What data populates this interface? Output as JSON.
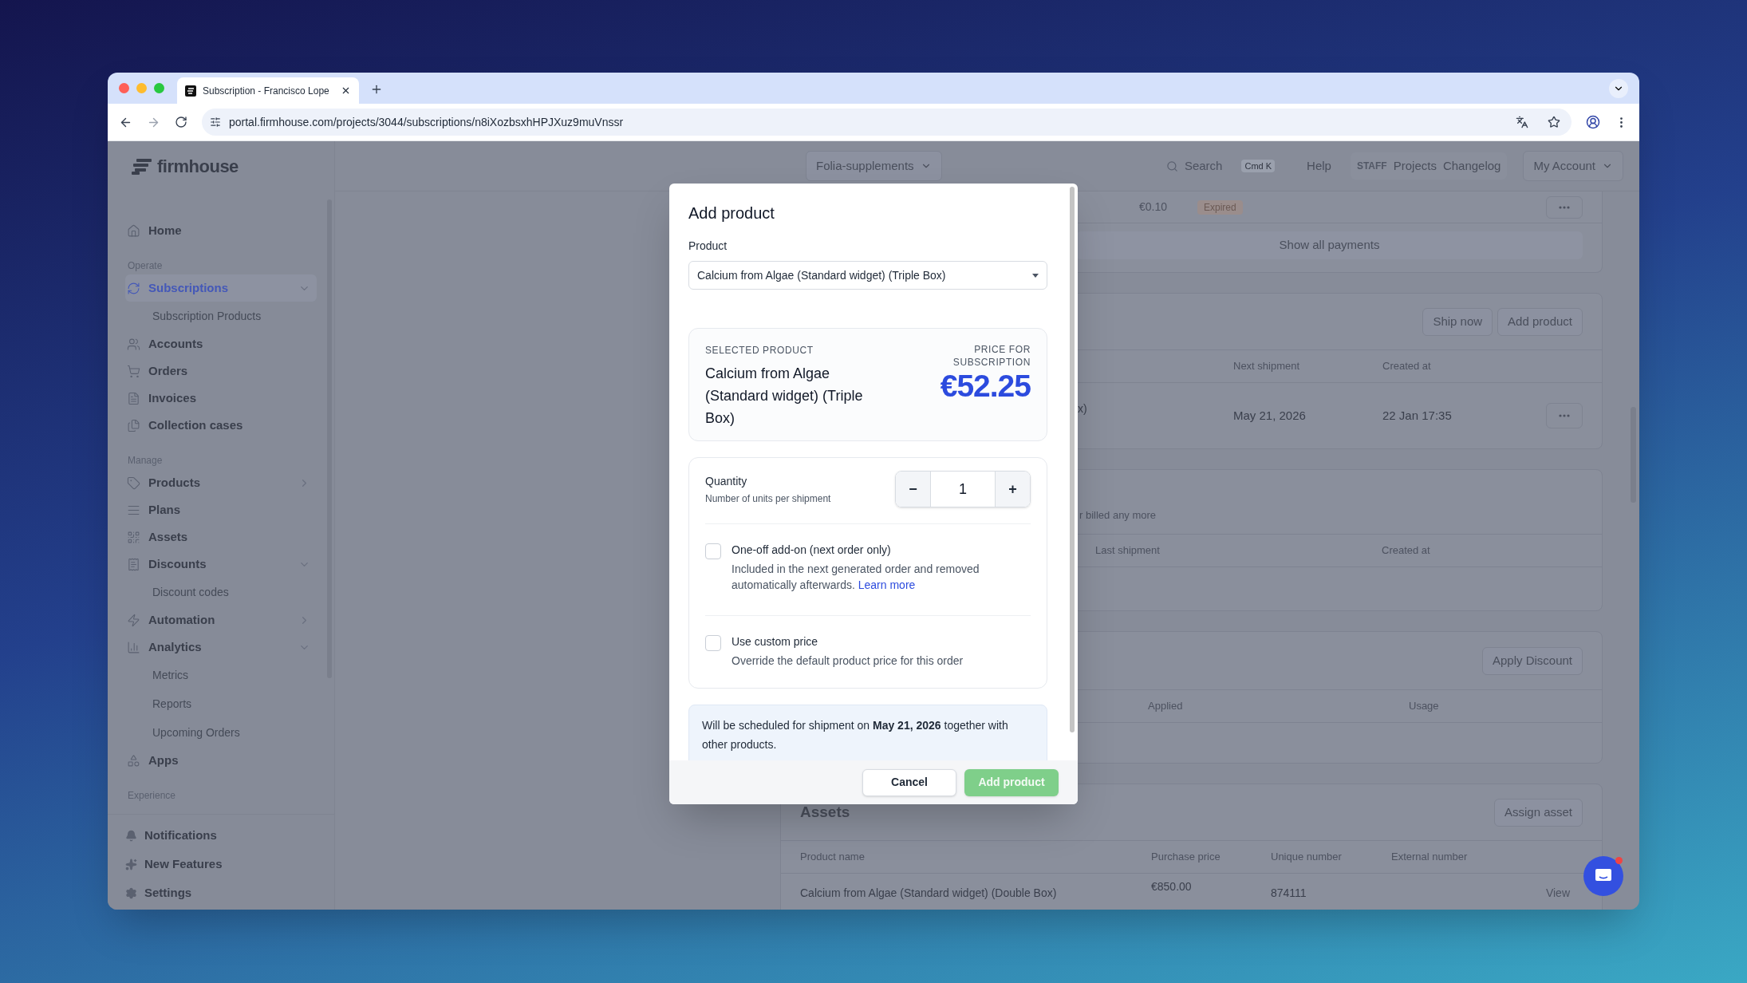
{
  "browser": {
    "tab_title": "Subscription - Francisco Lope",
    "url": "portal.firmhouse.com/projects/3044/subscriptions/n8iXozbsxhHPJXuz9muVnssr"
  },
  "sidebar": {
    "logo": "firmhouse",
    "nav": [
      {
        "kind": "item",
        "label": "Home",
        "selected": false
      },
      {
        "kind": "section",
        "label": "Operate"
      },
      {
        "kind": "item",
        "label": "Subscriptions",
        "selected": true,
        "expanded": true,
        "children": [
          {
            "label": "Subscription Products",
            "selected": false
          }
        ]
      },
      {
        "kind": "item",
        "label": "Accounts",
        "selected": false
      },
      {
        "kind": "item",
        "label": "Orders",
        "selected": false
      },
      {
        "kind": "item",
        "label": "Invoices",
        "selected": false
      },
      {
        "kind": "item",
        "label": "Collection cases",
        "selected": false
      },
      {
        "kind": "section",
        "label": "Manage"
      },
      {
        "kind": "item",
        "label": "Products",
        "selected": false,
        "expanded": false
      },
      {
        "kind": "item",
        "label": "Plans",
        "selected": false
      },
      {
        "kind": "item",
        "label": "Assets",
        "selected": false
      },
      {
        "kind": "item",
        "label": "Discounts",
        "selected": false,
        "expanded": true,
        "children": [
          {
            "label": "Discount codes",
            "selected": false
          }
        ]
      },
      {
        "kind": "item",
        "label": "Automation",
        "selected": false,
        "expanded": false
      },
      {
        "kind": "item",
        "label": "Analytics",
        "selected": false,
        "expanded": true,
        "children": [
          {
            "label": "Metrics",
            "selected": false
          },
          {
            "label": "Reports",
            "selected": false
          },
          {
            "label": "Upcoming Orders",
            "selected": false
          }
        ]
      },
      {
        "kind": "item",
        "label": "Apps",
        "selected": false
      },
      {
        "kind": "section",
        "label": "Experience"
      }
    ],
    "footer": [
      {
        "label": "Notifications"
      },
      {
        "label": "New Features"
      },
      {
        "label": "Settings"
      }
    ]
  },
  "header": {
    "project": "Folia-supplements",
    "search_placeholder": "Search",
    "search_shortcut": "Cmd K",
    "help": "Help",
    "staff_badge": "STAFF",
    "staff_links": [
      "Projects",
      "Changelog"
    ],
    "account": "My Account"
  },
  "payments_card": {
    "amount": "€0.10",
    "status": "Expired",
    "show_all": "Show all payments"
  },
  "products_card": {
    "buttons": [
      "Ship now",
      "Add product"
    ],
    "columns": [
      "Next shipment",
      "Created at"
    ],
    "row": {
      "product": "x)",
      "next_shipment": "May 21, 2026",
      "created_at": "22 Jan 17:35"
    }
  },
  "ended_card": {
    "note": "r billed any more",
    "columns": [
      "Last shipment",
      "Created at"
    ]
  },
  "discounts_card": {
    "button": "Apply Discount",
    "columns": [
      "Applied",
      "Usage"
    ]
  },
  "assets_card": {
    "title": "Assets",
    "button": "Assign asset",
    "columns": [
      "Product name",
      "Purchase price",
      "Unique number",
      "External number"
    ],
    "row": {
      "product_name": "Calcium from Algae (Standard widget) (Double Box)",
      "purchase_price": "€850.00",
      "unique_number": "874111",
      "action": "View"
    }
  },
  "chat": {
    "unread": true
  },
  "modal": {
    "title": "Add product",
    "product_label": "Product",
    "product_value": "Calcium from Algae (Standard widget) (Triple Box)",
    "selected_label": "SELECTED PRODUCT",
    "selected_name": "Calcium from Algae (Standard widget) (Triple Box)",
    "price_label": "PRICE FOR SUBSCRIPTION",
    "price": "€52.25",
    "quantity_label": "Quantity",
    "quantity_hint": "Number of units per shipment",
    "quantity": "1",
    "minus": "−",
    "plus": "+",
    "options": [
      {
        "label": "One-off add-on (next order only)",
        "description": "Included in the next generated order and removed automatically afterwards.",
        "link": "Learn more",
        "checked": false
      },
      {
        "label": "Use custom price",
        "description": "Override the default product price for this order",
        "checked": false
      }
    ],
    "schedule_note": "Will be scheduled for shipment on **May 21, 2026** together with other products.",
    "buttons": [
      {
        "label": "Cancel",
        "kind": "secondary",
        "disabled": false
      },
      {
        "label": "Add product",
        "kind": "primary",
        "disabled": true
      }
    ]
  }
}
